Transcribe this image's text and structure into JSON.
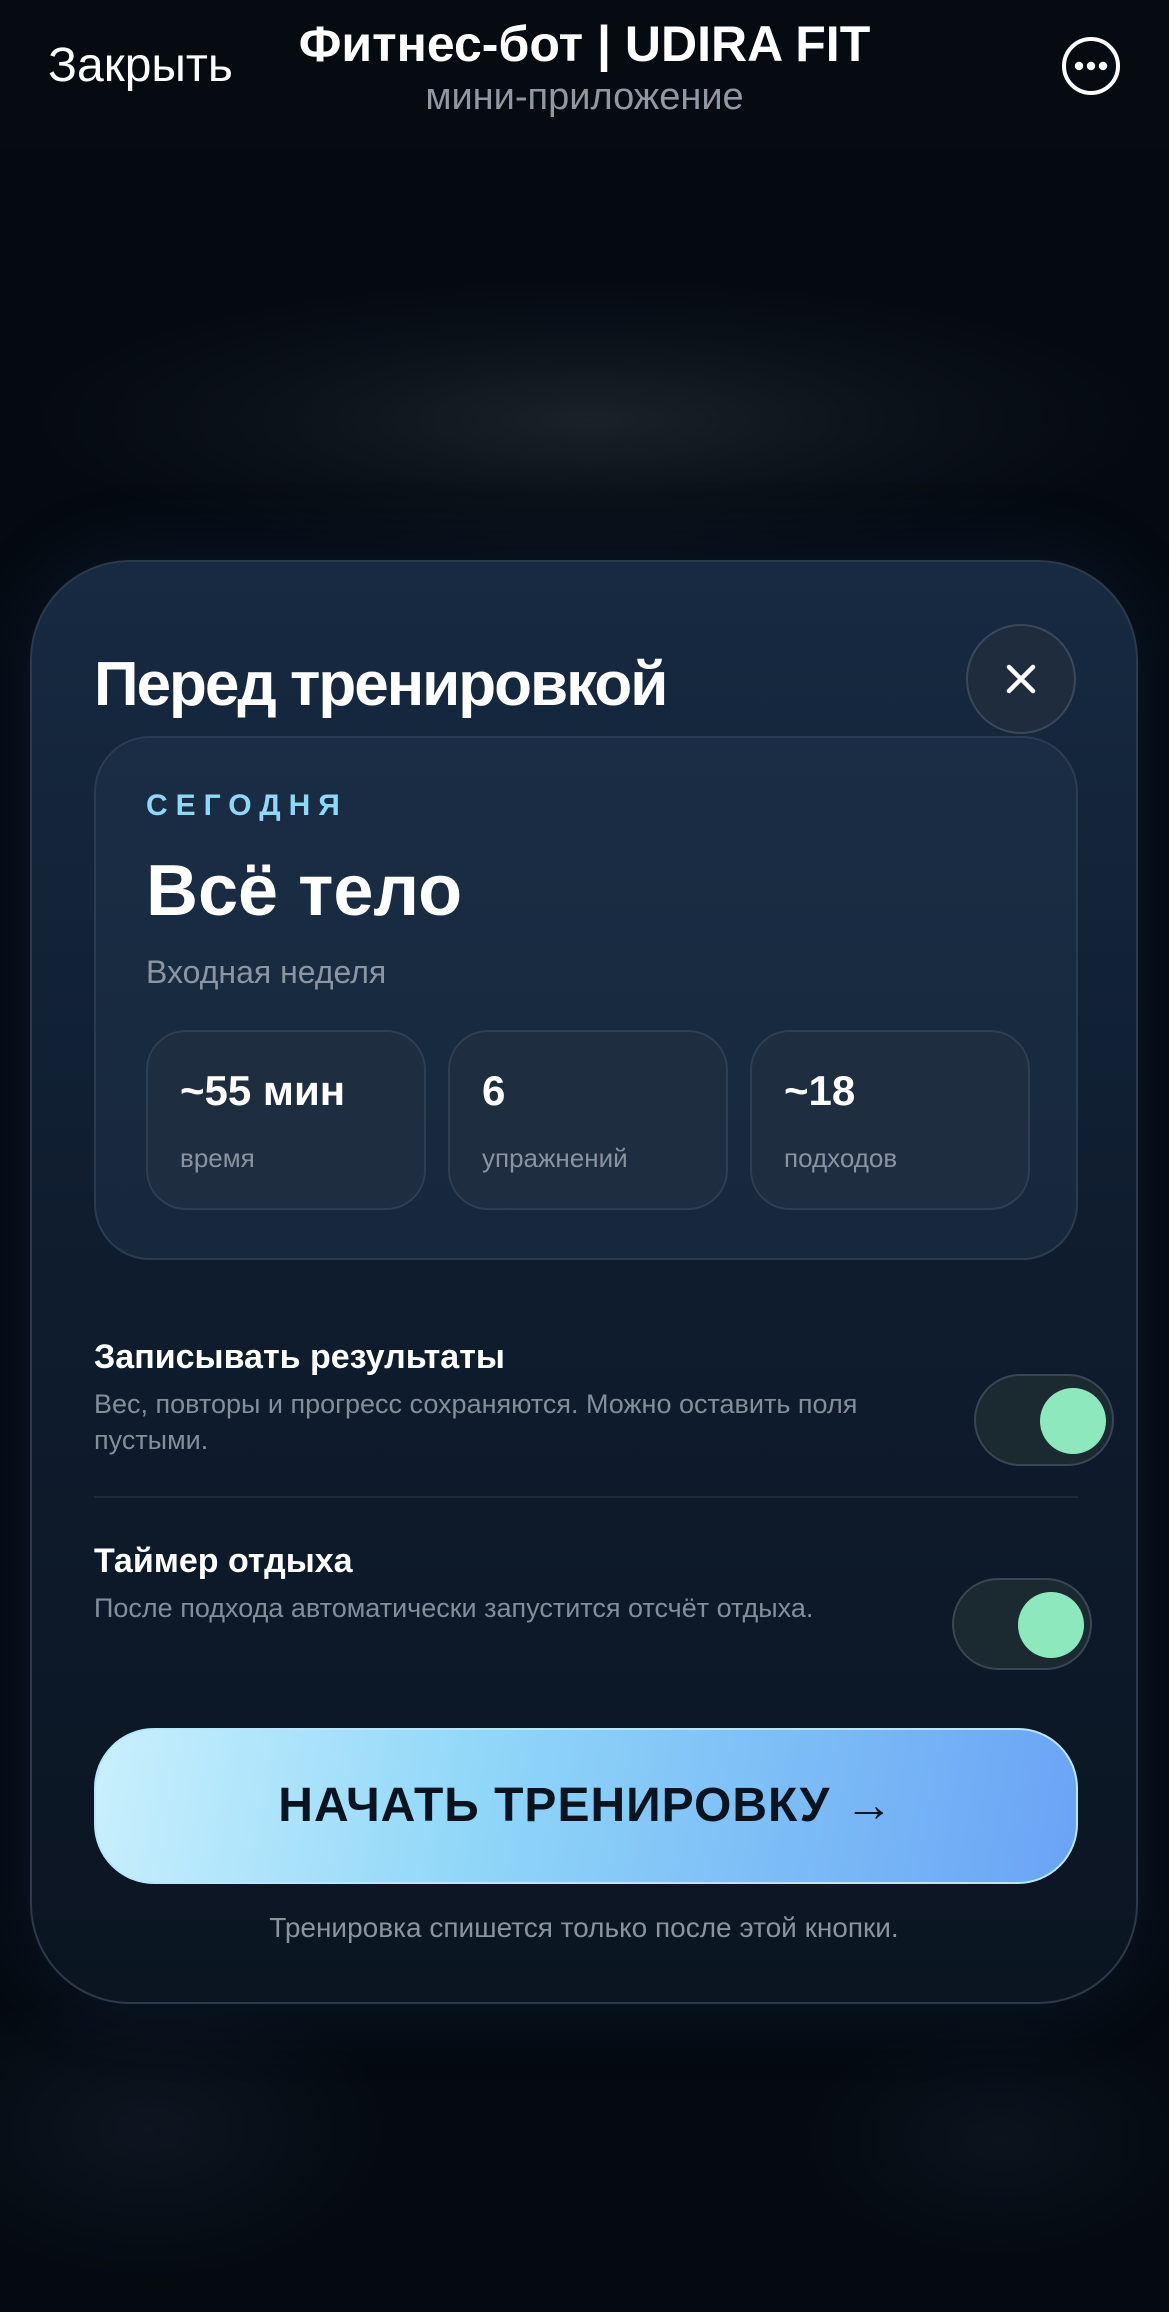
{
  "header": {
    "close_label": "Закрыть",
    "title": "Фитнес-бот | UDIRA FIT",
    "subtitle": "мини-приложение"
  },
  "modal": {
    "title": "Перед тренировкой",
    "today": {
      "label": "СЕГОДНЯ",
      "name": "Всё тело",
      "subtitle": "Входная неделя",
      "stats": [
        {
          "value": "~55 мин",
          "label": "время"
        },
        {
          "value": "6",
          "label": "упражнений"
        },
        {
          "value": "~18",
          "label": "подходов"
        }
      ]
    },
    "settings": [
      {
        "title": "Записывать результаты",
        "description": "Вес, повторы и прогресс сохраняются. Можно оставить поля пустыми.",
        "enabled": true
      },
      {
        "title": "Таймер отдыха",
        "description": "После подхода автоматически запустится отсчёт отдыха.",
        "enabled": true
      }
    ],
    "start_button_label": "НАЧАТЬ ТРЕНИРОВКУ →",
    "start_note": "Тренировка спишется только после этой кнопки."
  },
  "colors": {
    "accent": "#8fd6f8",
    "toggle_on": "#8ee8be",
    "today_label": "#8fd8f7"
  }
}
